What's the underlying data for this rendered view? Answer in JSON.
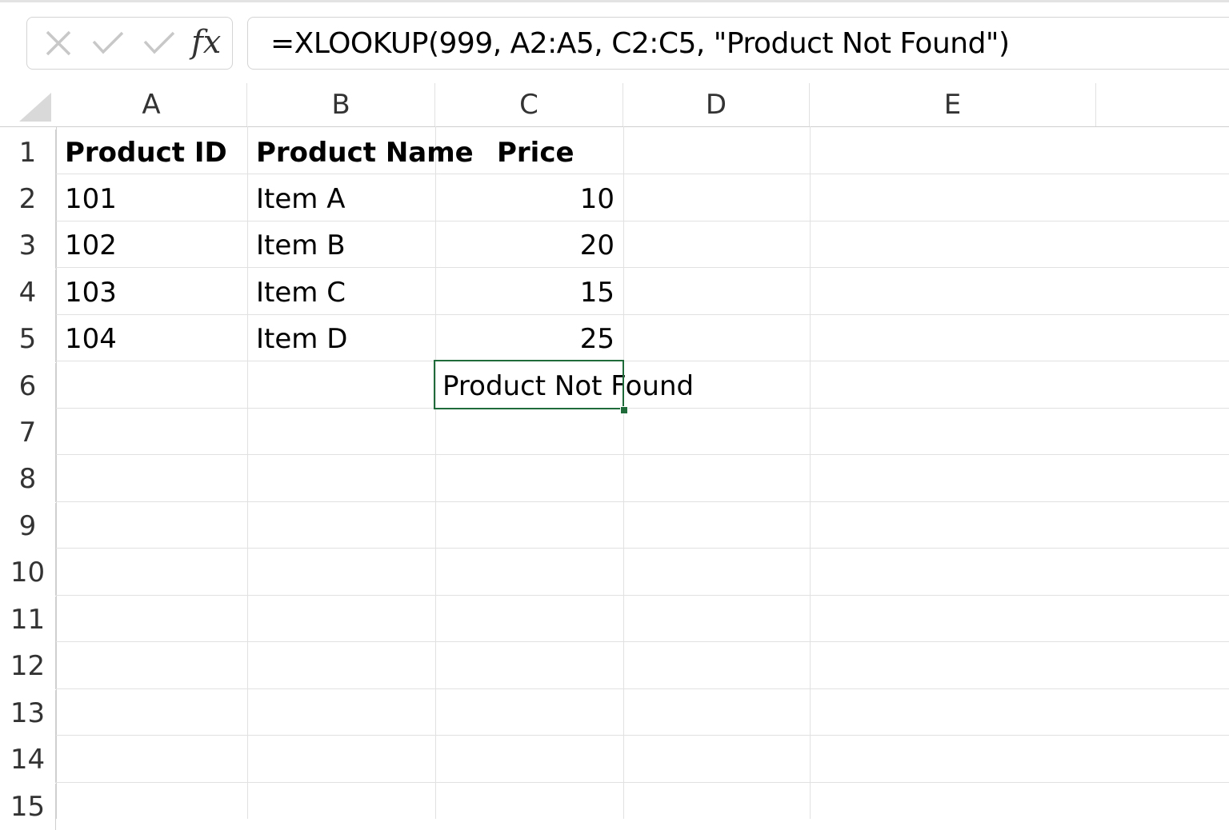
{
  "formula_bar": {
    "fx_label": "fx",
    "formula": "=XLOOKUP(999, A2:A5, C2:C5, \"Product Not Found\")"
  },
  "columns": [
    "A",
    "B",
    "C",
    "D",
    "E"
  ],
  "rows": [
    "1",
    "2",
    "3",
    "4",
    "5",
    "6",
    "7",
    "8",
    "9",
    "10",
    "11",
    "12",
    "13",
    "14",
    "15"
  ],
  "cells": {
    "A1": "Product ID",
    "B1": "Product Name",
    "C1": "Price",
    "A2": "101",
    "B2": "Item A",
    "C2": "10",
    "A3": "102",
    "B3": "Item B",
    "C3": "20",
    "A4": "103",
    "B4": "Item C",
    "C4": "15",
    "A5": "104",
    "B5": "Item D",
    "C5": "25",
    "C6": "Product Not Found"
  },
  "selected_cell": "C6",
  "colors": {
    "selection": "#1f6b3a",
    "gridline": "#e1e1e1",
    "header_text": "#333333"
  }
}
